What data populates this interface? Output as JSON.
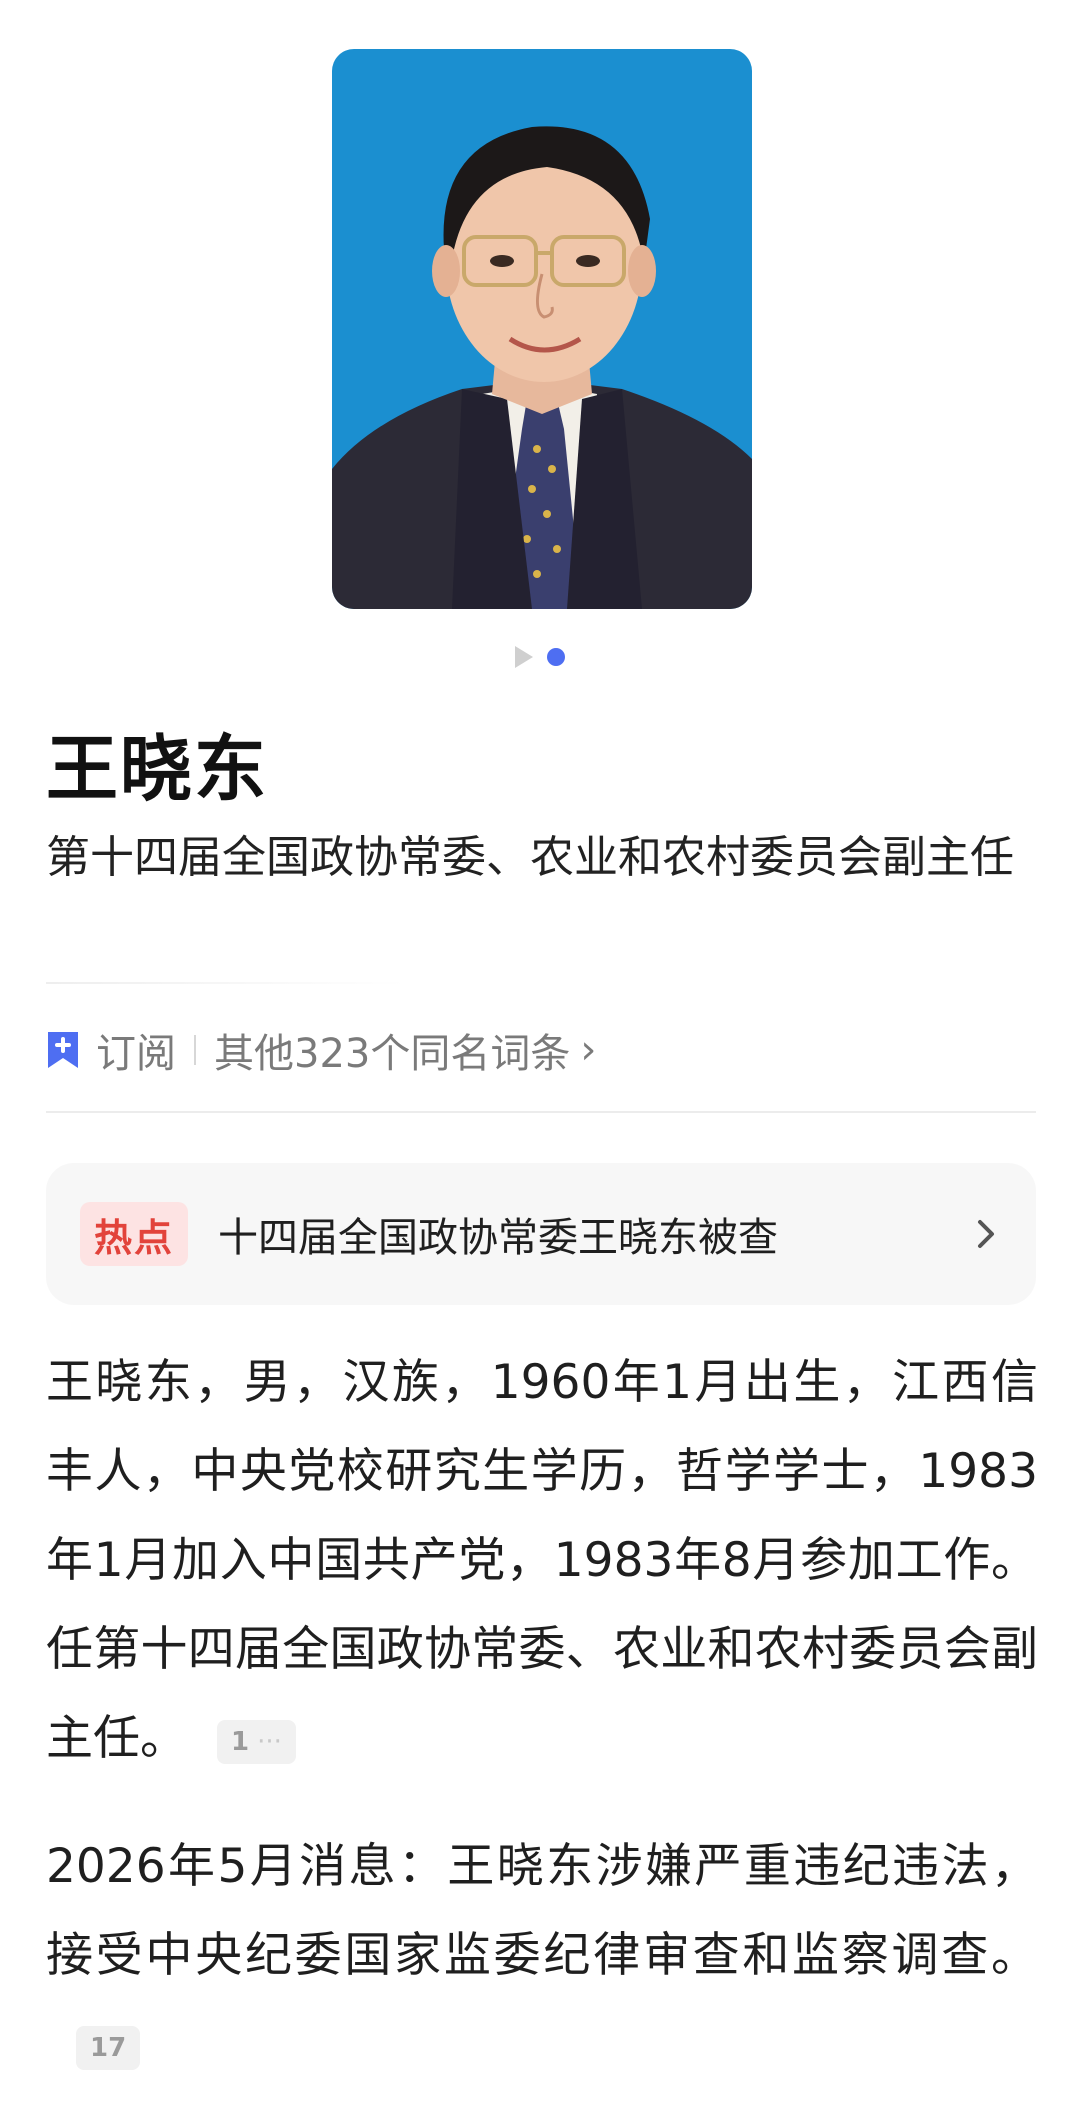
{
  "carousel": {
    "total": 2,
    "active_index": 1
  },
  "person": {
    "name": "王晓东",
    "description": "第十四届全国政协常委、农业和农村委员会副主任"
  },
  "actions": {
    "subscribe_label": "订阅",
    "same_name_label": "其他323个同名词条"
  },
  "hot": {
    "badge": "热点",
    "headline": "十四届全国政协常委王晓东被查"
  },
  "summary": {
    "text": "王晓东，男，汉族，1960年1月出生，江西信丰人，中央党校研究生学历，哲学学士，1983年1月加入中国共产党，1983年8月参加工作。任第十四届全国政协常委、农业和农村委员会副主任。",
    "ref_label": "1",
    "ref_more": "···"
  },
  "news": {
    "text": "2026年5月消息：王晓东涉嫌严重违纪违法，接受中央纪委国家监委纪律审查和监察调查。",
    "ref_label": "17"
  },
  "colors": {
    "accent": "#4e6ef2",
    "hot_badge_bg": "#fde3e3",
    "hot_badge_text": "#e2433b",
    "photo_background": "#1b8fd0"
  }
}
